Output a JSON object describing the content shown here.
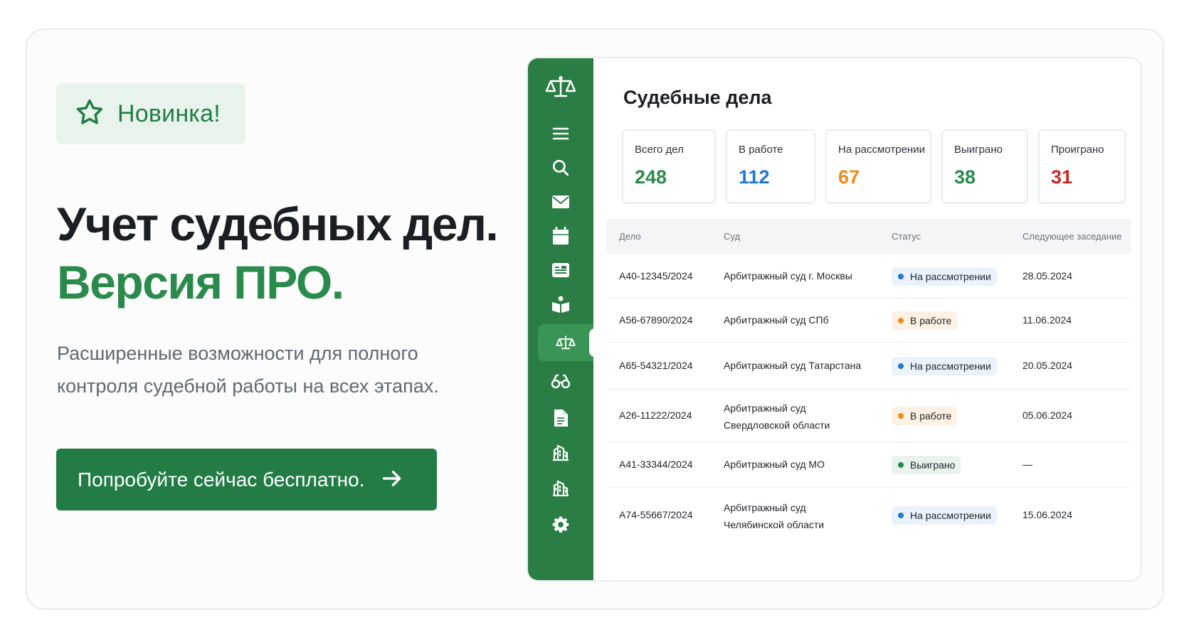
{
  "promo": {
    "badge": {
      "icon": "star-icon",
      "label": "Новинка!"
    },
    "title_line1": "Учет судебных дел.",
    "title_line2": "Версия ПРО.",
    "subtitle_line1": "Расширенные возможности для полного",
    "subtitle_line2": "контроля судебной работы на всех этапах.",
    "cta": {
      "label": "Попробуйте сейчас бесплатно.",
      "icon": "arrow-right-icon"
    }
  },
  "sidebar": {
    "logo": "scales-logo-icon",
    "items": [
      {
        "icon": "menu-icon"
      },
      {
        "icon": "search-icon"
      },
      {
        "icon": "mail-icon"
      },
      {
        "icon": "calendar-icon"
      },
      {
        "icon": "card-icon"
      },
      {
        "icon": "book-icon"
      },
      {
        "icon": "scales-icon",
        "active": true
      },
      {
        "icon": "glasses-icon"
      },
      {
        "icon": "document-icon"
      },
      {
        "icon": "building-icon"
      },
      {
        "icon": "building-icon"
      },
      {
        "icon": "gear-icon"
      }
    ]
  },
  "main": {
    "title": "Судебные дела",
    "stats": [
      {
        "label": "Всего дел",
        "value": "248",
        "color": "#2a8a4c"
      },
      {
        "label": "В работе",
        "value": "112",
        "color": "#1f78d1"
      },
      {
        "label": "На рассмотрении",
        "value": "67",
        "color": "#ef8a1c"
      },
      {
        "label": "Выиграно",
        "value": "38",
        "color": "#2a8a4c"
      },
      {
        "label": "Проиграно",
        "value": "31",
        "color": "#c62828"
      }
    ],
    "table": {
      "columns": [
        "Дело",
        "Суд",
        "Статус",
        "Следующее заседание"
      ],
      "rows": [
        {
          "case": "А40-12345/2024",
          "court": [
            "Арбитражный суд г. Москвы"
          ],
          "status": "На рассмотрении",
          "status_color": "#1f78d1",
          "date": "28.05.2024"
        },
        {
          "case": "А56-67890/2024",
          "court": [
            "Арбитражный суд СПб"
          ],
          "status": "В работе",
          "status_color": "#ef8a1c",
          "date": "11.06.2024"
        },
        {
          "case": "А65-54321/2024",
          "court": [
            "Арбитражный суд Татарстана"
          ],
          "status": "На рассмотрении",
          "status_color": "#1f78d1",
          "date": "20.05.2024"
        },
        {
          "case": "А26-11222/2024",
          "court": [
            "Арбитражный суд",
            "Свердловской области"
          ],
          "status": "В работе",
          "status_color": "#ef8a1c",
          "date": "05.06.2024"
        },
        {
          "case": "А41-33344/2024",
          "court": [
            "Арбитражный суд МО"
          ],
          "status": "Выиграно",
          "status_color": "#2a8a4c",
          "date": "—"
        },
        {
          "case": "А74-55667/2024",
          "court": [
            "Арбитражный суд",
            "Челябинской области"
          ],
          "status": "На рассмотрении",
          "status_color": "#1f78d1",
          "date": "15.06.2024"
        }
      ]
    }
  }
}
